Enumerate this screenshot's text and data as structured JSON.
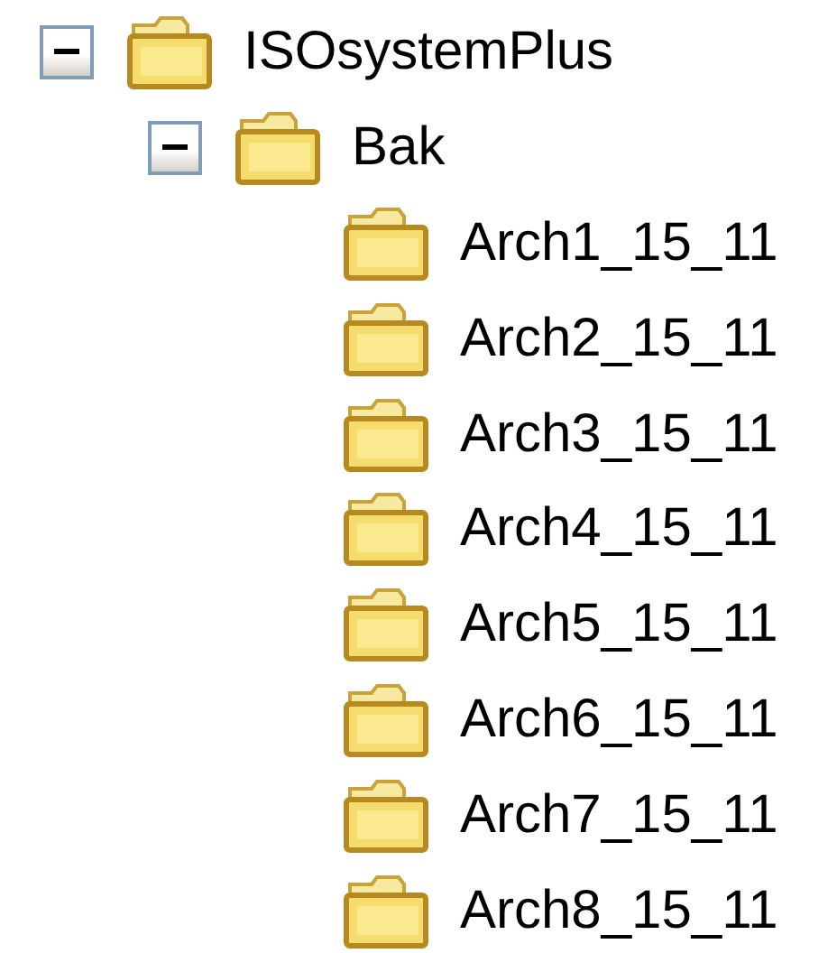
{
  "tree": [
    {
      "label": "ISOsystemPlus",
      "expanded": true,
      "children": [
        {
          "label": "Bak",
          "expanded": true,
          "children": [
            {
              "label": "Arch1_15_11"
            },
            {
              "label": "Arch2_15_11"
            },
            {
              "label": "Arch3_15_11"
            },
            {
              "label": "Arch4_15_11"
            },
            {
              "label": "Arch5_15_11"
            },
            {
              "label": "Arch6_15_11"
            },
            {
              "label": "Arch7_15_11"
            },
            {
              "label": "Arch8_15_11"
            }
          ]
        }
      ]
    }
  ]
}
